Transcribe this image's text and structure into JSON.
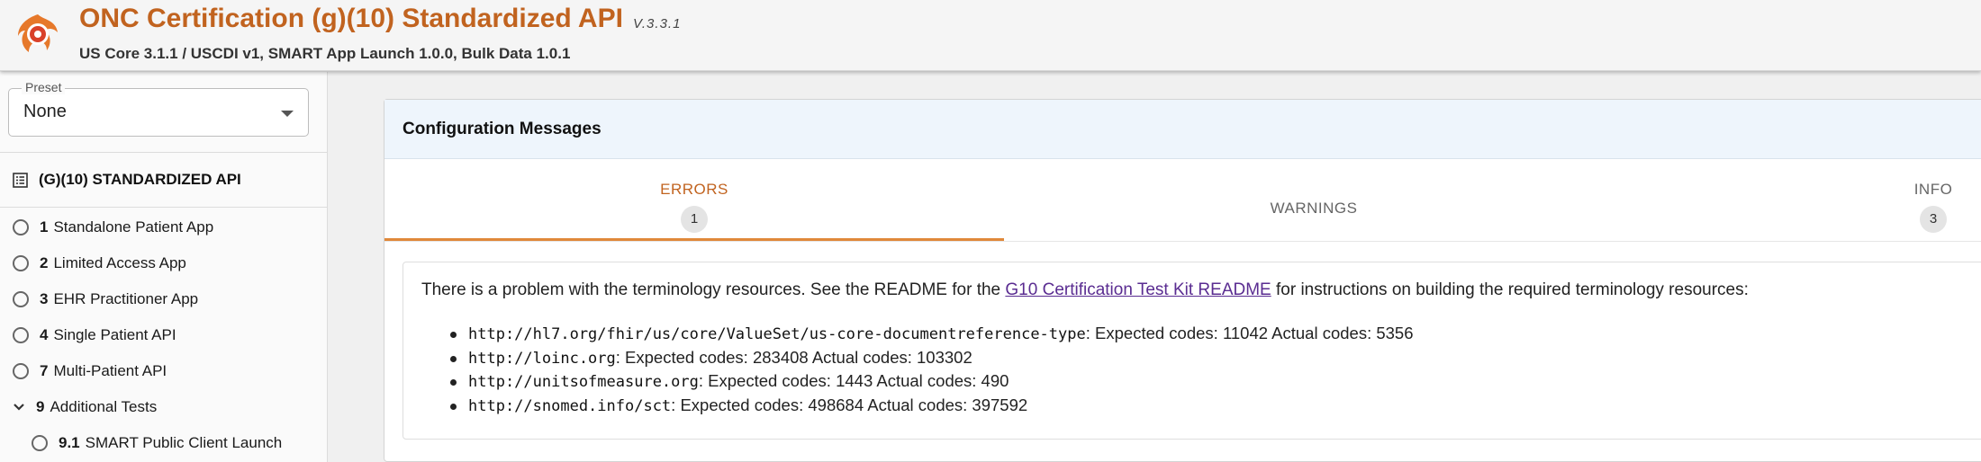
{
  "header": {
    "title": "ONC Certification (g)(10) Standardized API",
    "version": "V.3.3.1",
    "subtitle": "US Core 3.1.1 / USCDI v1, SMART App Launch 1.0.0, Bulk Data 1.0.1",
    "logo_icon": "inferno-flame-logo-icon",
    "accent_color": "#c1631f"
  },
  "sidebar": {
    "preset": {
      "legend": "Preset",
      "value": "None"
    },
    "suite_title": "(G)(10) STANDARDIZED API",
    "items": [
      {
        "num": "1",
        "label": "Standalone Patient App",
        "icon": "radio-icon"
      },
      {
        "num": "2",
        "label": "Limited Access App",
        "icon": "radio-icon"
      },
      {
        "num": "3",
        "label": "EHR Practitioner App",
        "icon": "radio-icon"
      },
      {
        "num": "4",
        "label": "Single Patient API",
        "icon": "radio-icon"
      },
      {
        "num": "7",
        "label": "Multi-Patient API",
        "icon": "radio-icon"
      },
      {
        "num": "9",
        "label": "Additional Tests",
        "icon": "chevron-down-icon"
      },
      {
        "num": "9.1",
        "label": "SMART Public Client Launch",
        "icon": "radio-icon"
      }
    ]
  },
  "main": {
    "panel_title": "Configuration Messages",
    "tabs": [
      {
        "label": "ERRORS",
        "count": "1",
        "active": true
      },
      {
        "label": "WARNINGS",
        "count": ""
      },
      {
        "label": "INFO",
        "count": "3"
      }
    ],
    "message": {
      "before_link": "There is a problem with the terminology resources. See the README for the ",
      "link_text": "G10 Certification Test Kit README",
      "after_link": " for instructions on building the required terminology resources:",
      "items": [
        {
          "url": "http://hl7.org/fhir/us/core/ValueSet/us-core-documentreference-type",
          "detail": ": Expected codes: 11042 Actual codes: 5356"
        },
        {
          "url": "http://loinc.org",
          "detail": ": Expected codes: 283408 Actual codes: 103302"
        },
        {
          "url": "http://unitsofmeasure.org",
          "detail": ": Expected codes: 1443 Actual codes: 490"
        },
        {
          "url": "http://snomed.info/sct",
          "detail": ": Expected codes: 498684 Actual codes: 397592"
        }
      ]
    }
  }
}
